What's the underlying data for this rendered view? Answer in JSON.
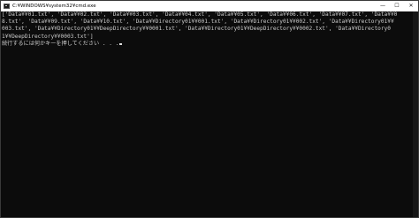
{
  "window": {
    "title": "C:¥WINDOWS¥system32¥cmd.exe",
    "controls": {
      "minimize": "—",
      "maximize": "☐",
      "close": "✕"
    }
  },
  "console": {
    "lines": [
      "['Data¥¥01.txt', 'Data¥¥02.txt', 'Data¥¥03.txt', 'Data¥¥04.txt', 'Data¥¥05.txt', 'Data¥¥06.txt', 'Data¥¥07.txt', 'Data¥¥0",
      "8.txt', 'Data¥¥09.txt', 'Data¥¥10.txt', 'Data¥¥Directory01¥¥001.txt', 'Data¥¥Directory01¥¥002.txt', 'Data¥¥Directory01¥¥",
      "003.txt', 'Data¥¥Directory01¥¥DeepDirectory¥¥0001.txt', 'Data¥¥Directory01¥¥DeepDirectory¥¥0002.txt', 'Data¥¥Directory0",
      "1¥¥DeepDirectory¥¥0003.txt']",
      "続行するには何かキーを押してください . . ."
    ]
  }
}
